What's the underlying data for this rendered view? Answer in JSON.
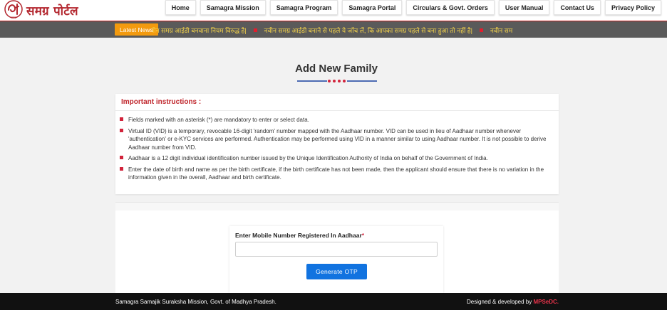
{
  "brand": {
    "logo_text": "समग्र पोर्टल",
    "logo_small": "समग्र"
  },
  "nav": {
    "items": [
      {
        "label": "Home"
      },
      {
        "label": "Samagra Mission"
      },
      {
        "label": "Samagra Program"
      },
      {
        "label": "Samagra Portal"
      },
      {
        "label": "Circulars & Govt. Orders"
      },
      {
        "label": "User Manual"
      },
      {
        "label": "Contact Us"
      },
      {
        "label": "Privacy Policy"
      }
    ]
  },
  "ticker": {
    "badge": "Latest News",
    "items": [
      "आईडी होते हुए नवीन समग्र आईडी बनवाना नियम विरुद्ध है|",
      "नवीन समग्र आईडी बनाने से पहले ये जाँच लें, कि आपका समग्र पहले से बना हुआ तो नहीं है|",
      "नवीन सम"
    ]
  },
  "page": {
    "title": "Add New Family"
  },
  "instructions": {
    "title": "Important instructions :",
    "items": [
      "Fields marked with an asterisk (*) are mandatory to enter or select data.",
      "Virtual ID (VID) is a temporary, revocable 16-digit 'random' number mapped with the Aadhaar number. VID can be used in lieu of Aadhaar number whenever 'authentication' or e-KYC services are performed. Authentication may be performed using VID in a manner similar to using Aadhaar number. It is not possible to derive Aadhaar number from VID.",
      "Aadhaar is a 12 digit individual identification number issued by the Unique Identification Authority of India on behalf of the Government of India.",
      "Enter the date of birth and name as per the birth certificate, if the birth certificate has not been made, then the applicant should ensure that there is no variation in the information given in the overall, Aadhaar and birth certificate."
    ]
  },
  "form": {
    "mobile_label": "Enter Mobile Number Registered In Aadhaar",
    "required_mark": "*",
    "mobile_value": "",
    "mobile_placeholder": "",
    "submit_label": "Generate OTP"
  },
  "footer": {
    "left_text": "Samagra Samajik Suraksha Mission, Govt. of Madhya Pradesh.",
    "right_prefix": "Designed & developed by ",
    "right_brand": "MPSeDC."
  },
  "colors": {
    "brand_red": "#b3262e",
    "accent_red": "#d2233b",
    "ticker_bg": "#5a5a5a",
    "ticker_text": "#f3d24a",
    "badge_orange": "#f39a0e",
    "button_blue": "#1173e0",
    "footer_bg": "#111111"
  }
}
